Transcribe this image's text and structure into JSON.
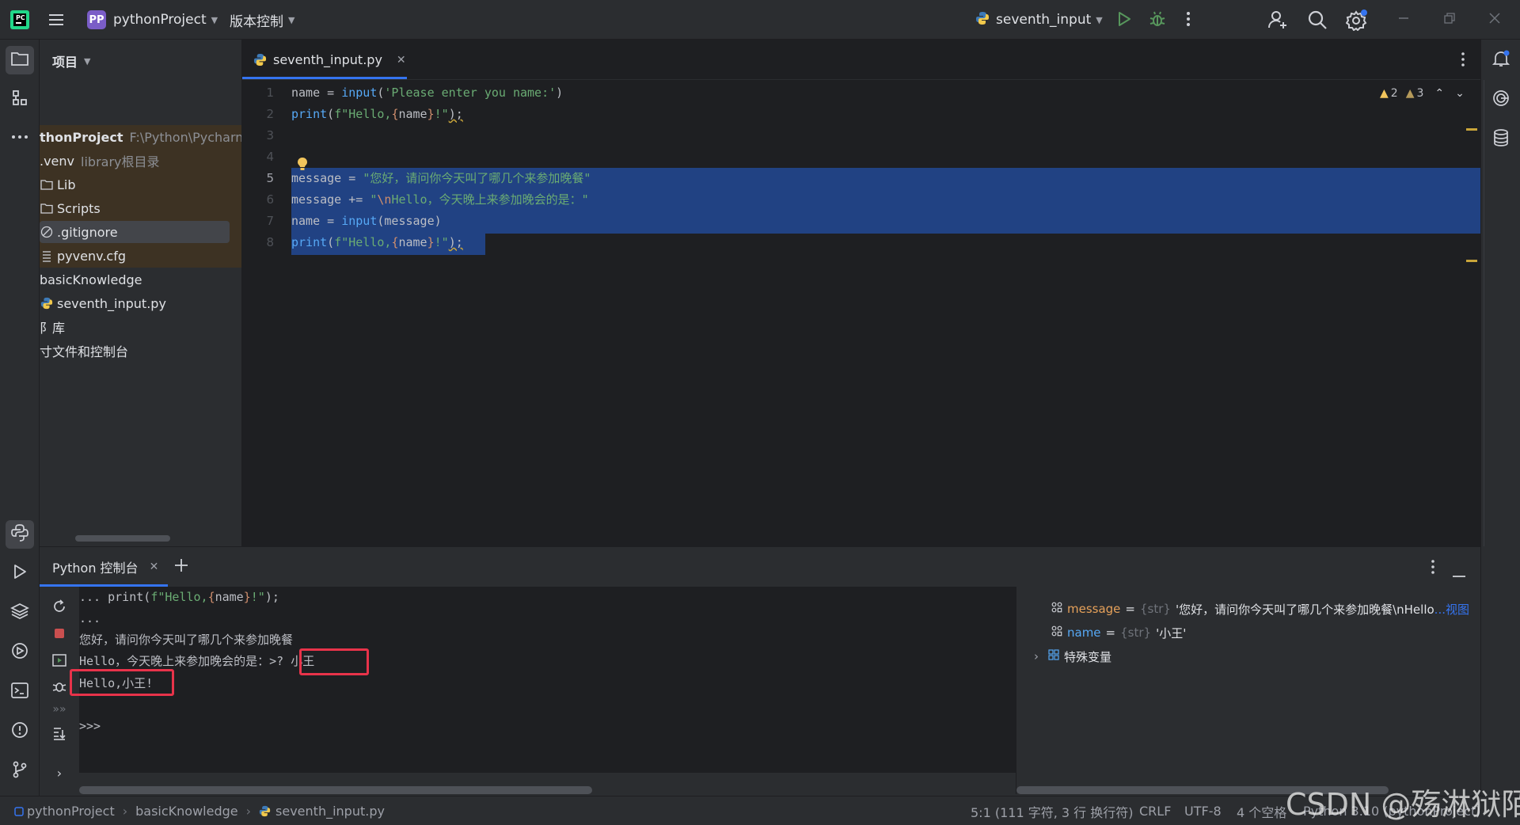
{
  "titlebar": {
    "project_badge": "PP",
    "project_name": "pythonProject",
    "vcs_label": "版本控制",
    "run_config": "seventh_input"
  },
  "project_panel": {
    "title": "项目",
    "items": [
      {
        "label": "thonProject",
        "hint": "F:\\Python\\PycharmP"
      },
      {
        "label": ".venv",
        "hint": "library根目录"
      },
      {
        "label": "Lib"
      },
      {
        "label": "Scripts"
      },
      {
        "label": ".gitignore"
      },
      {
        "label": "pyvenv.cfg"
      },
      {
        "label": "basicKnowledge"
      },
      {
        "label": "seventh_input.py"
      },
      {
        "label": "阝库"
      },
      {
        "label": "寸文件和控制台"
      }
    ]
  },
  "editor": {
    "tab_label": "seventh_input.py",
    "inspection": {
      "warnings": "2",
      "weak_warnings": "3"
    },
    "line_numbers": [
      "1",
      "2",
      "3",
      "4",
      "5",
      "6",
      "7",
      "8"
    ],
    "lines": {
      "l1": {
        "a": "name = ",
        "b": "input",
        "c": "(",
        "d": "'Please enter you name:'",
        "e": ")"
      },
      "l2": {
        "a": "print",
        "b": "(",
        "c": "f\"Hello,",
        "d": "{",
        "e": "name",
        "f": "}",
        "g": "!\"",
        "h": ");"
      },
      "l5": {
        "a": "message = ",
        "b": "\"您好，请问你今天叫了哪几个来参加晚餐\""
      },
      "l6": {
        "a": "message += ",
        "b": "\"",
        "c": "\\n",
        "d": "Hello，今天晚上来参加晚会的是：\""
      },
      "l7": {
        "a": "name = ",
        "b": "input",
        "c": "(message)"
      },
      "l8": {
        "a": "print",
        "b": "(",
        "c": "f\"Hello,",
        "d": "{",
        "e": "name",
        "f": "}",
        "g": "!\"",
        "h": ");"
      }
    }
  },
  "console": {
    "tab_label": "Python 控制台",
    "output": [
      "... print(f\"Hello,{name}!\");",
      "...",
      "您好，请问你今天叫了哪几个来参加晚餐",
      "Hello，今天晚上来参加晚会的是：>? ",
      "Hello,小王!",
      "",
      ">>> "
    ],
    "input_value": "小王",
    "highlight_color": "#e8334a"
  },
  "variables": [
    {
      "name": "message",
      "eq": "=",
      "type": "{str}",
      "value": "'您好，请问你今天叫了哪几个来参加晚餐\\nHello",
      "more": "...视图"
    },
    {
      "name": "name",
      "eq": "=",
      "type": "{str}",
      "value": "'小王'"
    },
    {
      "name": "特殊变量"
    }
  ],
  "statusbar": {
    "breadcrumbs": [
      "pythonProject",
      "basicKnowledge",
      "seventh_input.py"
    ],
    "position": "5:1 (111 字符, 3 行 换行符)",
    "line_ending": "CRLF",
    "encoding": "UTF-8",
    "indent": "4 个空格",
    "interpreter": "Python 3.10 (pythonProject)"
  },
  "watermark": "CSDN @殇淋狱陌"
}
